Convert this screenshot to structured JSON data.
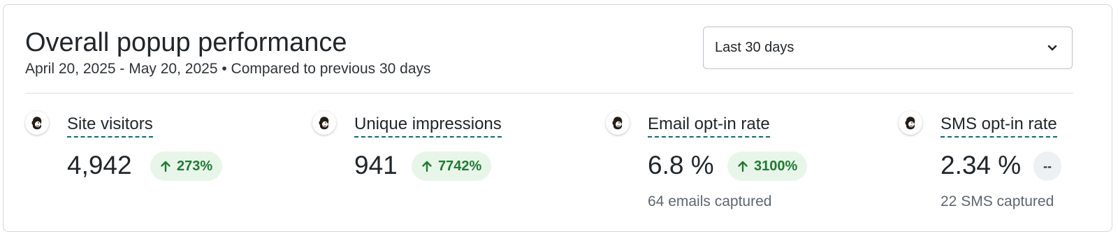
{
  "header": {
    "title": "Overall popup performance",
    "subtitle": "April 20, 2025 - May 20, 2025 • Compared to previous 30 days"
  },
  "date_range": {
    "selected": "Last 30 days",
    "icon": "chevron-down-icon"
  },
  "metrics": [
    {
      "label": "Site visitors",
      "value": "4,942",
      "change": "273%",
      "change_direction": "up",
      "sub": ""
    },
    {
      "label": "Unique impressions",
      "value": "941",
      "change": "7742%",
      "change_direction": "up",
      "sub": ""
    },
    {
      "label": "Email opt-in rate",
      "value": "6.8 %",
      "change": "3100%",
      "change_direction": "up",
      "sub": "64 emails captured"
    },
    {
      "label": "SMS opt-in rate",
      "value": "2.34 %",
      "change": "--",
      "change_direction": "none",
      "sub": "22 SMS captured"
    }
  ],
  "colors": {
    "positive_badge_bg": "#e8f6ea",
    "positive_badge_text": "#1f7a32",
    "neutral_badge_bg": "#eef1f4",
    "label_underline": "#0a6e77",
    "text_primary": "#21262b",
    "text_secondary": "#5d6670"
  }
}
